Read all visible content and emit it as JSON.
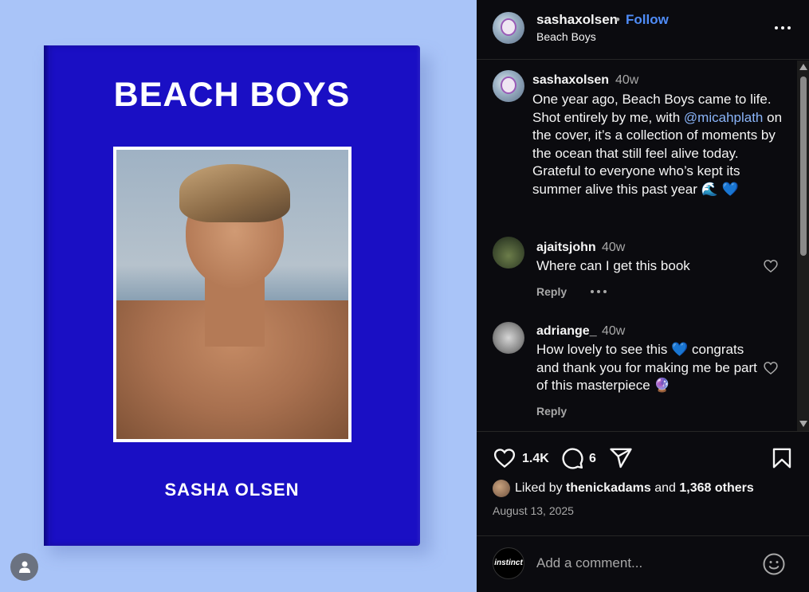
{
  "media": {
    "book_title": "BEACH BOYS",
    "book_author": "SASHA OLSEN",
    "background_color": "#a9c4f8",
    "cover_color": "#1a0fc4"
  },
  "header": {
    "username": "sashaxolsen",
    "separator": "•",
    "follow_label": "Follow",
    "subtitle": "Beach Boys",
    "more_icon": "more-horizontal-icon"
  },
  "caption": {
    "username": "sashaxolsen",
    "time": "40w",
    "text_before_mention": "One year ago, Beach Boys came to life. Shot entirely by me, with ",
    "mention": "@micahplath",
    "text_after_mention": " on the cover, it’s a collection of moments by the ocean that still feel alive today.",
    "text_line2": "Grateful to everyone who’s kept its summer alive this past year 🌊 💙"
  },
  "comments": [
    {
      "username": "ajaitsjohn",
      "time": "40w",
      "text": "Where can I get this book",
      "reply_label": "Reply"
    },
    {
      "username": "adriange_",
      "time": "40w",
      "text": "How lovely to see this 💙 congrats and thank you for making me be part of this masterpiece 🔮",
      "reply_label": "Reply"
    }
  ],
  "actions": {
    "likes_count": "1.4K",
    "comments_count": "6",
    "icons": [
      "heart-icon",
      "comment-icon",
      "share-icon",
      "bookmark-icon"
    ]
  },
  "likes": {
    "prefix": "Liked by ",
    "user": "thenickadams",
    "middle": " and ",
    "others": "1,368 others"
  },
  "date": "August 13, 2025",
  "add_comment": {
    "avatar_text": "instinct",
    "placeholder": "Add a comment..."
  },
  "colors": {
    "panel_bg": "#0b0b0f",
    "link_blue": "#4f8cf7",
    "mention_blue": "#8ab4f8",
    "muted_text": "#a8a8a8"
  }
}
